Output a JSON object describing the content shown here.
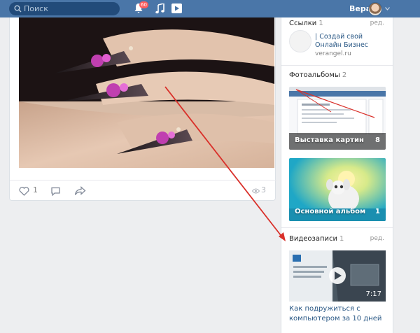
{
  "header": {
    "search_placeholder": "Поиск",
    "notifications_count": "60",
    "user_name": "Вера"
  },
  "post": {
    "likes": "1",
    "views": "3"
  },
  "links": {
    "title": "Ссылки",
    "count": "1",
    "edit": "ред.",
    "item_title": "| Создай свой Онлайн Бизнес",
    "item_url": "verangel.ru"
  },
  "albums": {
    "title": "Фотоальбомы",
    "count": "2",
    "items": [
      {
        "label": "Выставка картин",
        "count": "8"
      },
      {
        "label": "Основной альбом",
        "count": "1"
      }
    ]
  },
  "videos": {
    "title": "Видеозаписи",
    "count": "1",
    "edit": "ред.",
    "item_duration": "7:17",
    "item_title": "Как подружиться с компьютером за 10 дней"
  },
  "colors": {
    "header_bg": "#4a76a8",
    "link": "#2a5885",
    "annotation_arrow": "#d9302a"
  }
}
